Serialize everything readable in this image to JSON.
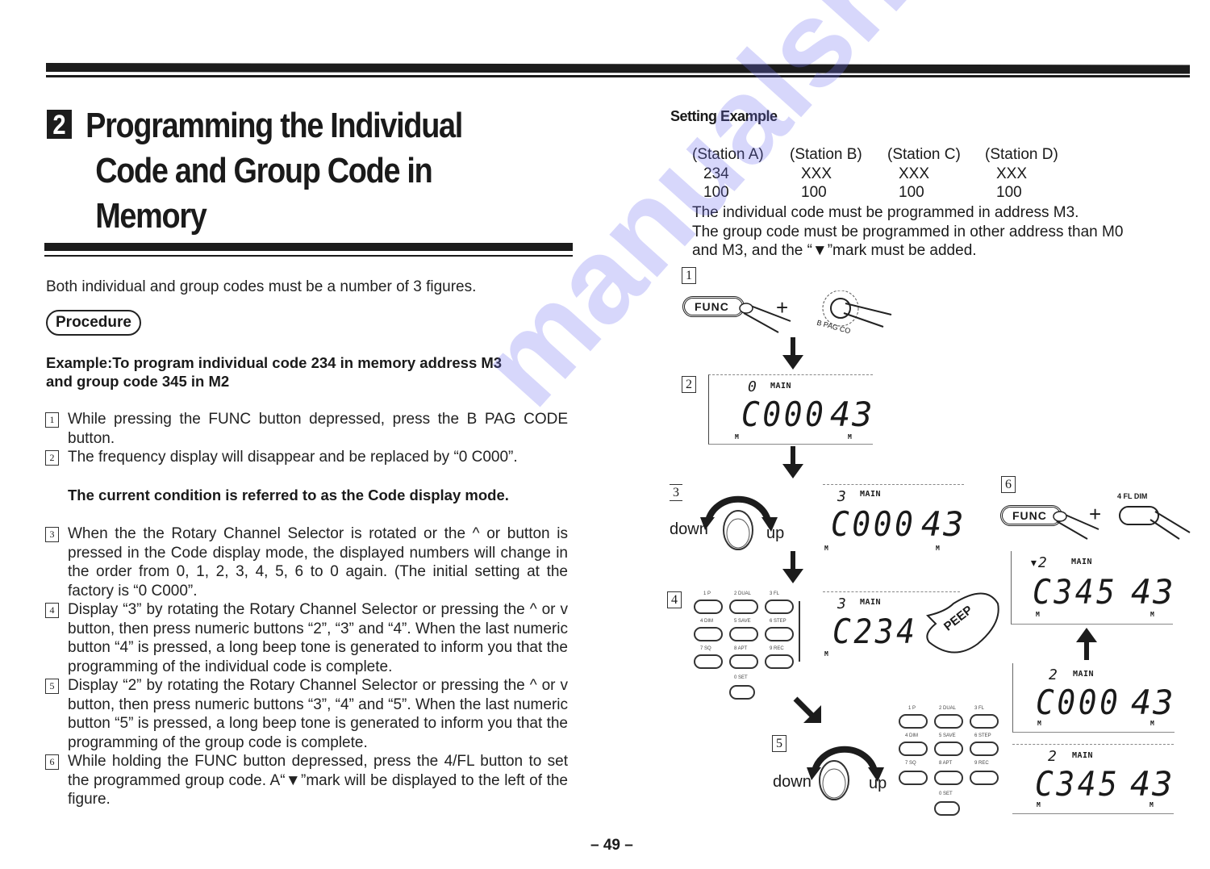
{
  "section": {
    "number": "2",
    "title_lines": [
      "Programming the Individual",
      "Code and Group Code in",
      "Memory"
    ]
  },
  "intro": "Both individual and group codes must be a number of 3 figures.",
  "procedure_label": "Procedure",
  "example": {
    "line1": "Example:To program individual code 234 in memory address M3",
    "line2": "and group code 345 in M2"
  },
  "steps": [
    {
      "num": "1",
      "text": "While pressing the FUNC button depressed, press the B PAG CODE button."
    },
    {
      "num": "2",
      "text": "The frequency display will disappear and be replaced by “0 C000”."
    },
    {
      "num": "3",
      "text": "When the the Rotary Channel Selector is rotated or the ^ or button is pressed in the Code display mode, the displayed numbers will change in the order from 0, 1, 2, 3, 4, 5, 6 to 0 again. (The initial setting at the factory is “0 C000”."
    },
    {
      "num": "4",
      "text": "Display “3” by rotating the Rotary Channel Selector or pressing the ^ or v button, then press numeric buttons “2”, “3” and “4”. When the last numeric button “4” is pressed, a long beep tone is generated to inform you that the programming of the individual code is complete."
    },
    {
      "num": "5",
      "text": "Display “2” by rotating the Rotary Channel Selector or pressing the ^ or v button, then press numeric buttons “3”, “4” and “5”. When the last numeric button “5” is pressed, a long beep tone is generated to inform you that the programming of the group code is complete."
    },
    {
      "num": "6",
      "text": "While holding the FUNC button depressed, press the 4/FL button to set the programmed group code. A“▼”mark will be displayed to the left of the figure."
    }
  ],
  "code_mode_note": "The current condition is referred to as the Code display mode.",
  "page_number": "– 49 –",
  "setting_example": {
    "title": "Setting Example",
    "stations": [
      "(Station A)",
      "(Station B)",
      "(Station C)",
      "(Station D)"
    ],
    "individual_codes": [
      "234",
      "XXX",
      "XXX",
      "XXX"
    ],
    "group_codes": [
      "100",
      "100",
      "100",
      "100"
    ],
    "notes": [
      "The individual code must be programmed in address M3.",
      "The group code must be programmed in other address than M0",
      "and M3, and the “▼”mark must be added."
    ]
  },
  "figure": {
    "step_labels": [
      "1",
      "2",
      "3",
      "4",
      "5",
      "6"
    ],
    "func_label": "FUNC",
    "plus": "+",
    "bpag_label": "B PAG CO",
    "fl_label": "4 FL DIM",
    "down_label": "down",
    "up_label": "up",
    "peep_label": "PEEP",
    "main_label": "MAIN",
    "m_label": "M",
    "displays": {
      "step2": {
        "mem": "0",
        "code": "C000",
        "channel": "43"
      },
      "step3": {
        "mem": "3",
        "code": "C000",
        "channel": "43"
      },
      "step4": {
        "mem": "3",
        "code": "C234",
        "channel": ""
      },
      "step5a": {
        "mem": "2",
        "code": "C000",
        "channel": "43"
      },
      "step5b": {
        "mem": "2",
        "code": "C345",
        "channel": "43"
      },
      "step6": {
        "mem": "▾2",
        "code": "C345",
        "channel": "43"
      }
    },
    "keypad_labels": [
      "1 P",
      "2 DUAL",
      "3 FL",
      "4 DIM",
      "5 SAVE",
      "6 STEP",
      "7 SQ",
      "8 APT",
      "9 REC",
      "0 SET"
    ]
  },
  "watermark": "manualshive.com"
}
